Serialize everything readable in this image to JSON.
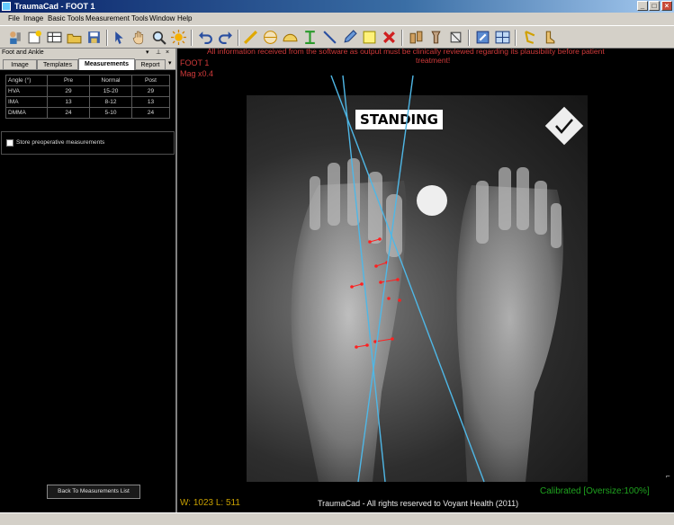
{
  "window": {
    "title": "TraumaCad - FOOT 1"
  },
  "menu": [
    "File",
    "Image",
    "Basic Tools",
    "Measurement Tools",
    "Window",
    "Help"
  ],
  "panel": {
    "title": "Foot and Ankle",
    "tabs": [
      "Image",
      "Templates",
      "Measurements",
      "Report"
    ],
    "active_tab": "Measurements",
    "table": {
      "headers": [
        "Angle (°)",
        "Pre",
        "Normal",
        "Post"
      ],
      "rows": [
        {
          "angle": "HVA",
          "pre": "29",
          "normal": "15-20",
          "post": "29"
        },
        {
          "angle": "IMA",
          "pre": "13",
          "normal": "8-12",
          "post": "13"
        },
        {
          "angle": "DMMA",
          "pre": "24",
          "normal": "5-10",
          "post": "24"
        }
      ]
    },
    "store_label": "Store preoperative measurements",
    "back_button": "Back To Measurements List"
  },
  "viewer": {
    "notice_line1": "All information received from the software as output must be clinically reviewed regarding its plausibility before patient",
    "notice_line2": "treatment!",
    "image_name": "FOOT 1",
    "magnification": "Mag x0.4",
    "standing_label": "STANDING",
    "window_level": "W:  1023 L:  511",
    "copyright": "TraumaCad -  All rights reserved to Voyant Health  (2011)",
    "calibration": "Calibrated [Oversize:100%]"
  },
  "colors": {
    "title_bar": "#0a246a",
    "measure_line": "#4fb7e6",
    "measure_point": "#ff2020",
    "overlay_text": "#d03a3a",
    "calibrated": "#1fa31f"
  }
}
